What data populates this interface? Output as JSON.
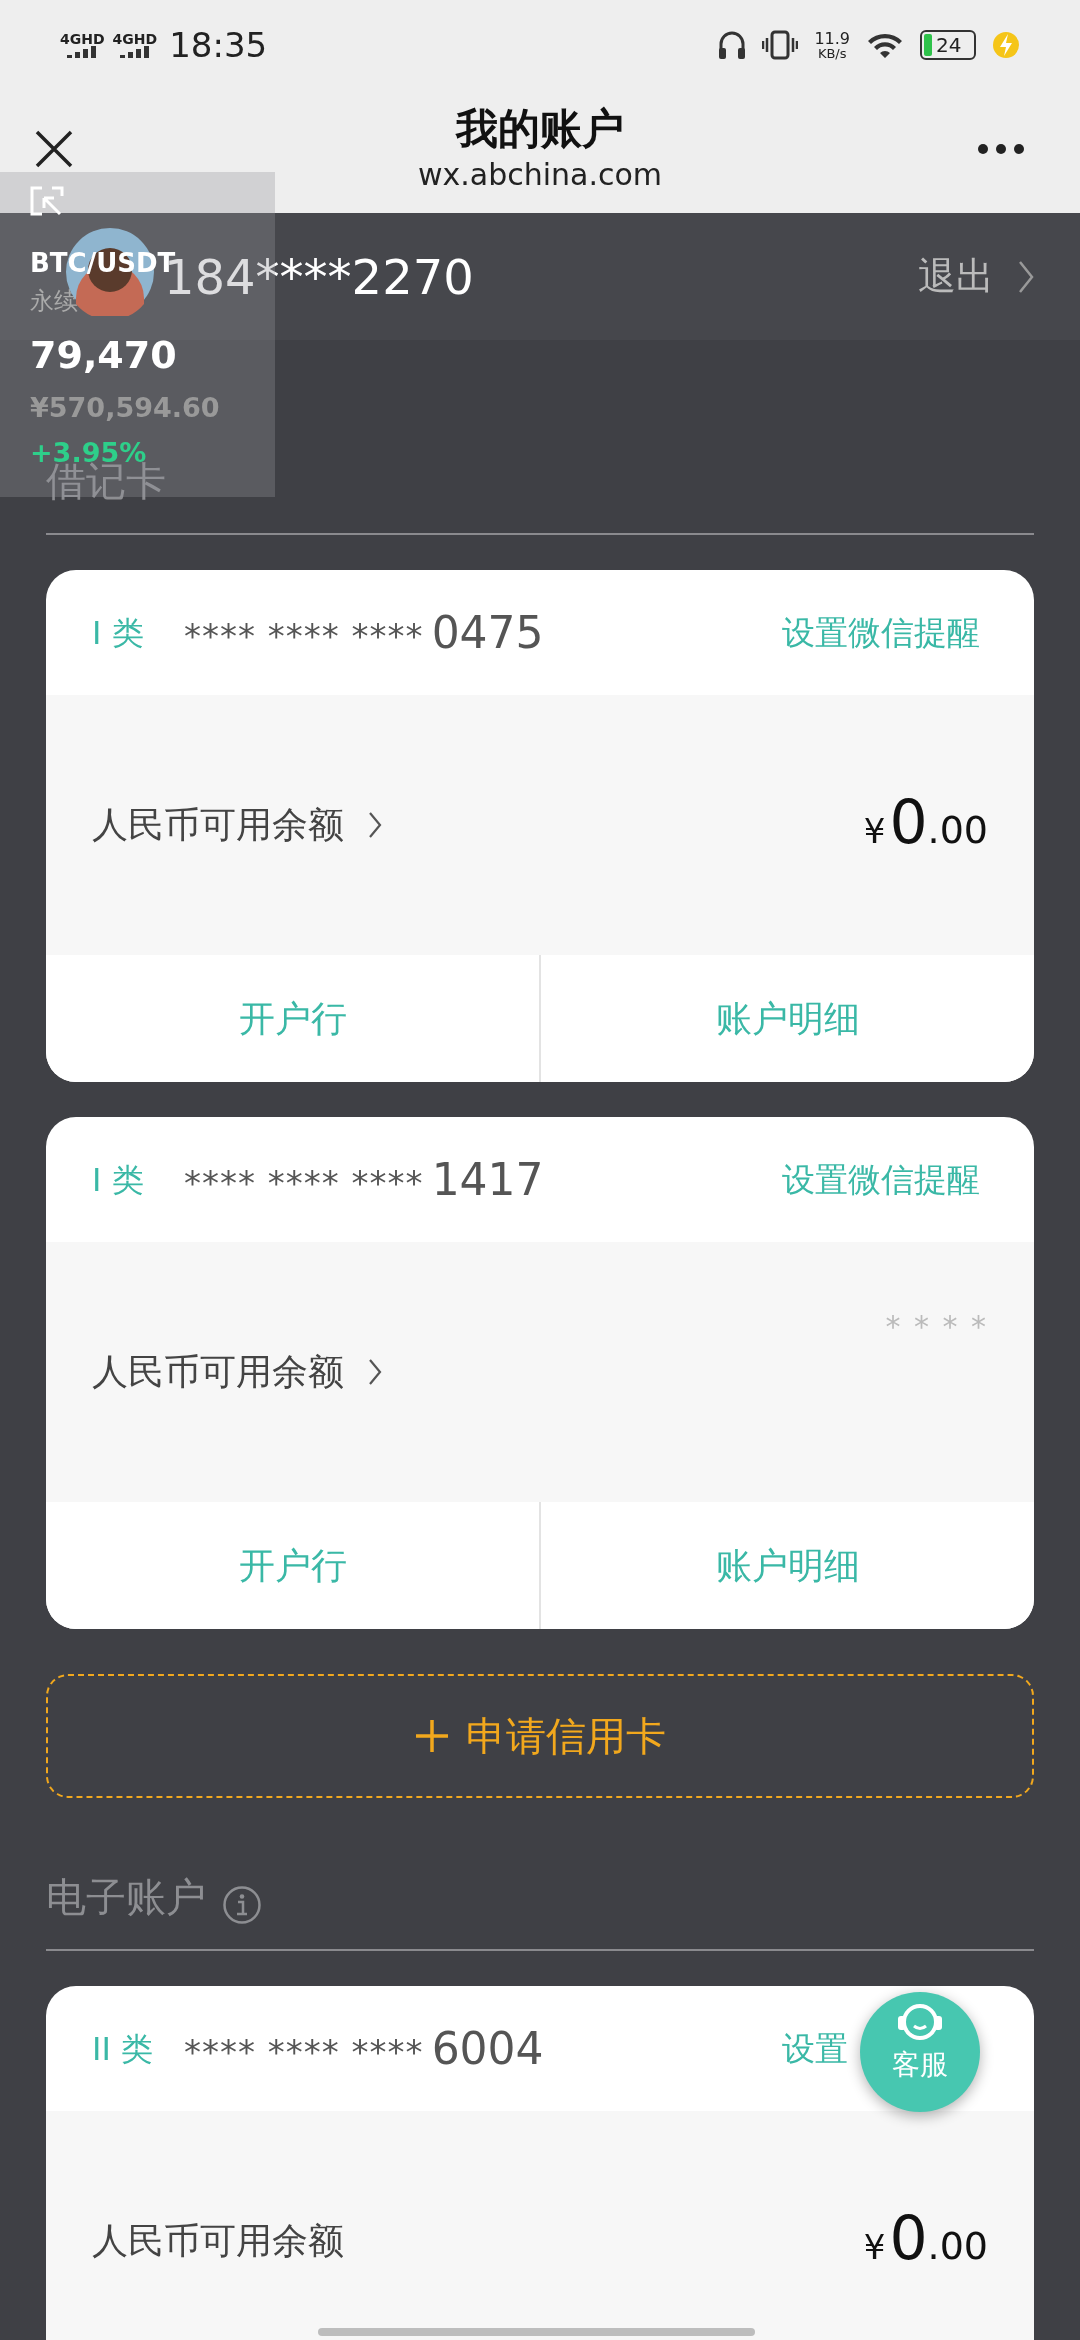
{
  "status_bar": {
    "signals": [
      {
        "label": "4GHD"
      },
      {
        "label": "4GHD"
      }
    ],
    "time": "18:35",
    "speed": "11.9",
    "speed_unit": "KB/s",
    "battery": "24",
    "charging": true
  },
  "header": {
    "title": "我的账户",
    "subtitle": "wx.abchina.com"
  },
  "account_bar": {
    "phone": "184****2270",
    "logout": "退出"
  },
  "sections": [
    {
      "kind": "accounts",
      "title": "借记卡",
      "info": false,
      "cards": [
        {
          "class_label": "I 类",
          "number_mask": "**** **** ****",
          "number_tail": "0475",
          "remind": "设置微信提醒",
          "balance_label": "人民币可用余额",
          "link": true,
          "balance": {
            "kind": "amount",
            "symbol": "¥",
            "integer": "0",
            "decimal": ".00"
          },
          "buttons": [
            "开户行",
            "账户明细"
          ]
        },
        {
          "class_label": "I 类",
          "number_mask": "**** **** ****",
          "number_tail": "1417",
          "remind": "设置微信提醒",
          "balance_label": "人民币可用余额",
          "link": true,
          "balance": {
            "kind": "masked",
            "text": "* * * *"
          },
          "buttons": [
            "开户行",
            "账户明细"
          ]
        }
      ]
    },
    {
      "kind": "apply",
      "label": "申请信用卡"
    },
    {
      "kind": "accounts",
      "title": "电子账户",
      "info": true,
      "cards": [
        {
          "class_label": "II 类",
          "number_mask": "**** **** ****",
          "number_tail": "6004",
          "remind": "设置",
          "balance_label": "人民币可用余额",
          "link": false,
          "balance": {
            "kind": "amount",
            "symbol": "¥",
            "integer": "0",
            "decimal": ".00"
          }
        }
      ]
    }
  ],
  "floating_widget": {
    "pair": "BTC/USDT",
    "contract": "永续",
    "price": "79,470",
    "price_cny": "¥570,594.60",
    "change": "+3.95%"
  },
  "support_button": {
    "label": "客服"
  }
}
